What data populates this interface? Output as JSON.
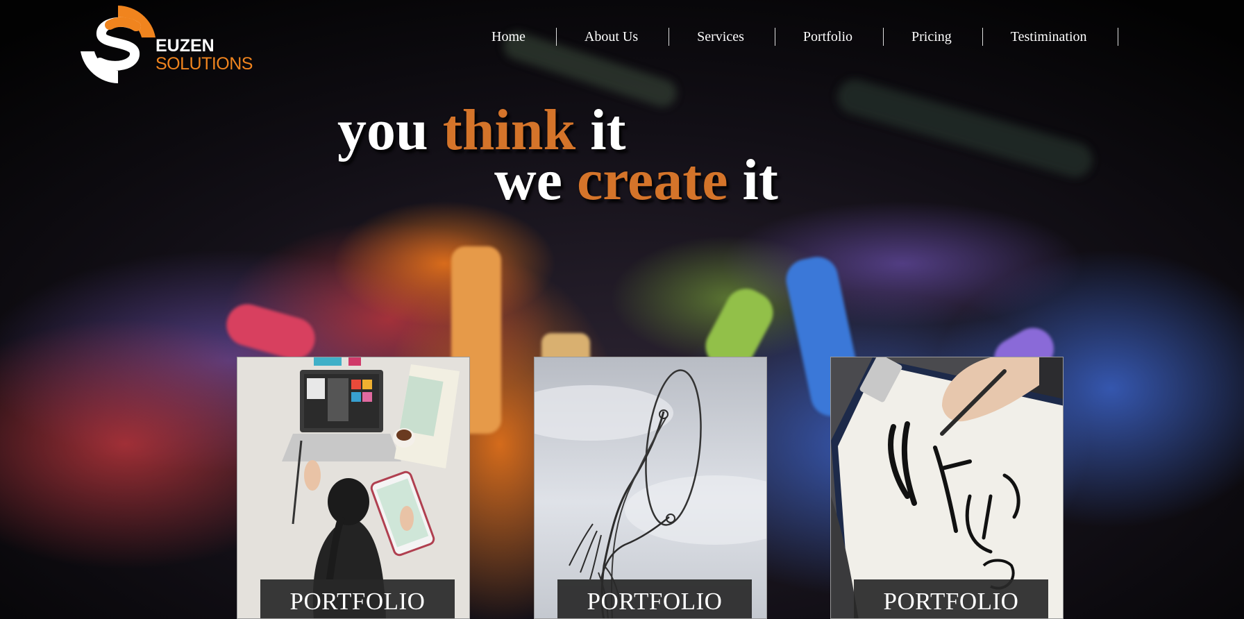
{
  "brand": {
    "name_line1": "EUZEN",
    "name_line2": "SOLUTIONS",
    "logo_icon": "s-swirl-logo-icon",
    "colors": {
      "accent": "#f0841e",
      "headline_accent": "#d4742a",
      "text": "#ffffff"
    }
  },
  "nav": {
    "items": [
      {
        "label": "Home"
      },
      {
        "label": "About Us"
      },
      {
        "label": "Services"
      },
      {
        "label": "Portfolio"
      },
      {
        "label": "Pricing"
      },
      {
        "label": "Testimination"
      }
    ]
  },
  "hero": {
    "line1": {
      "before": "you ",
      "accent": "think",
      "after": " it"
    },
    "line2": {
      "before": "we ",
      "accent": "create",
      "after": " it"
    },
    "background_icon": "colored-chalk-background"
  },
  "cards": [
    {
      "label": "PORTFOLIO",
      "image_icon": "designer-at-laptop-image"
    },
    {
      "label": "PORTFOLIO",
      "image_icon": "wire-sculpture-image"
    },
    {
      "label": "PORTFOLIO",
      "image_icon": "hand-drawing-sketch-image"
    }
  ]
}
